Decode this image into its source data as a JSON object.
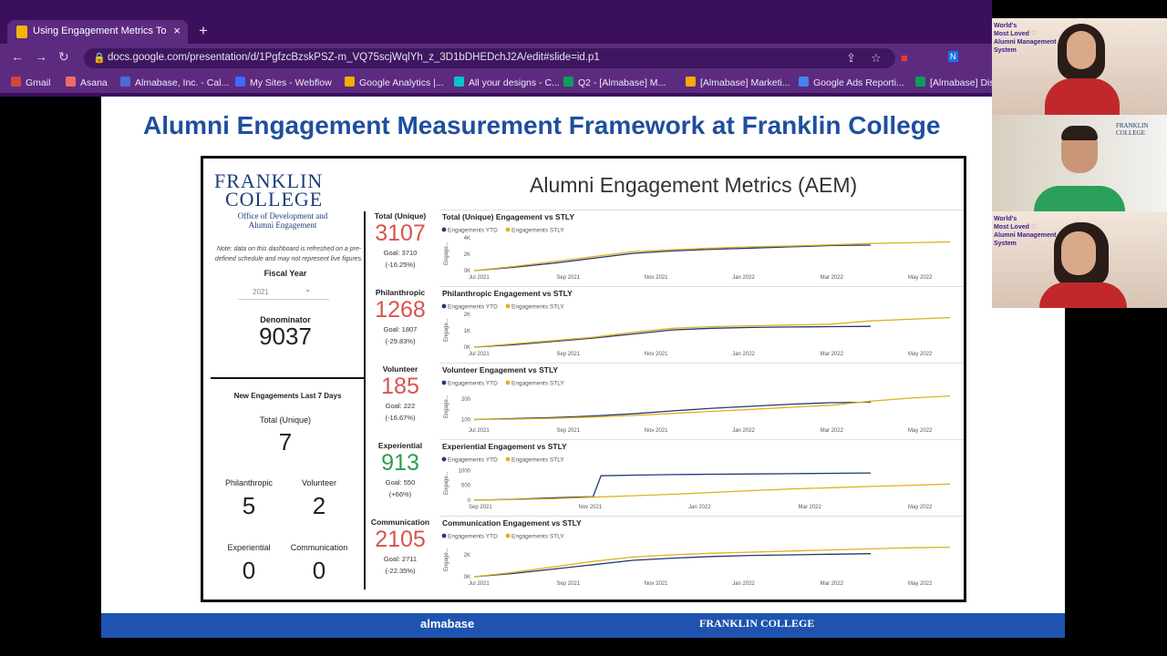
{
  "browser": {
    "tab_title": "Using Engagement Metrics To Dr",
    "url": "docs.google.com/presentation/d/1PgfzcBzskPSZ-m_VQ75scjWqlYh_z_3D1bDHEDchJ2A/edit#slide=id.p1",
    "bookmarks": [
      "Gmail",
      "Asana",
      "Almabase, Inc. - Cal...",
      "My Sites - Webflow",
      "Google Analytics |...",
      "All your designs - C...",
      "Q2 - [Almabase] M...",
      "[Almabase] Marketi...",
      "Google Ads Reporti...",
      "[Almabase] Dis"
    ],
    "bookmark_colors": [
      "#d44638",
      "#f06a6a",
      "#4a6bd6",
      "#3b6bff",
      "#f9ab00",
      "#00c4cc",
      "#0f9d58",
      "#f9ab00",
      "#4285f4",
      "#0f9d58"
    ]
  },
  "slide": {
    "title": "Alumni Engagement Measurement Framework at Franklin College",
    "footer_left": "almabase",
    "footer_right": "FRANKLIN COLLEGE"
  },
  "dashboard": {
    "logo_line1": "FRANKLIN",
    "logo_line2": "COLLEGE",
    "logo_sub1": "Office of Development and",
    "logo_sub2": "Alumni Engagement",
    "note": "Note: data on this dashboard is refreshed on a pre-defined schedule and may not represent live figures.",
    "fiscal_year_label": "Fiscal Year",
    "fiscal_year_value": "2021",
    "denominator_label": "Denominator",
    "denominator_value": "9037",
    "new_title": "New Engagements Last 7 Days",
    "total_unique_label": "Total (Unique)",
    "total_unique_value": "7",
    "philanthropic_label": "Philanthropic",
    "philanthropic_value": "5",
    "volunteer_label": "Volunteer",
    "volunteer_value": "2",
    "experiential_label": "Experiential",
    "experiential_value": "0",
    "communication_label": "Communication",
    "communication_value": "0",
    "title": "Alumni Engagement Metrics (AEM)",
    "kpis": [
      {
        "label": "Total (Unique)",
        "value": "3107",
        "goal": "Goal: 3710",
        "pct": "(-16.25%)",
        "color": "#d9534f"
      },
      {
        "label": "Philanthropic",
        "value": "1268",
        "goal": "Goal: 1807",
        "pct": "(-29.83%)",
        "color": "#d9534f"
      },
      {
        "label": "Volunteer",
        "value": "185",
        "goal": "Goal: 222",
        "pct": "(-16.67%)",
        "color": "#d9534f"
      },
      {
        "label": "Experiential",
        "value": "913",
        "goal": "Goal: 550",
        "pct": "(+66%)",
        "color": "#2e9e4a"
      },
      {
        "label": "Communication",
        "value": "2105",
        "goal": "Goal: 2711",
        "pct": "(-22.35%)",
        "color": "#d9534f"
      }
    ]
  },
  "chart_data": [
    {
      "type": "line",
      "title": "Total (Unique) Engagement vs STLY",
      "ylabel": "Engage...",
      "yticks": [
        "0K",
        "2K",
        "4K"
      ],
      "ylim": [
        0,
        4000
      ],
      "xticks": [
        "Jul 2021",
        "Sep 2021",
        "Nov 2021",
        "Jan 2022",
        "Mar 2022",
        "May 2022"
      ],
      "series": [
        {
          "name": "Engagements YTD",
          "color": "#1f3b73",
          "x": [
            0,
            1,
            2,
            3,
            4,
            5,
            6,
            7,
            8,
            9,
            10
          ],
          "values": [
            0,
            400,
            900,
            1500,
            2100,
            2400,
            2600,
            2750,
            2900,
            3050,
            3107
          ]
        },
        {
          "name": "Engagements STLY",
          "color": "#e0b020",
          "x": [
            0,
            1,
            2,
            3,
            4,
            5,
            6,
            7,
            8,
            9,
            10,
            11,
            12
          ],
          "values": [
            0,
            500,
            1100,
            1700,
            2300,
            2550,
            2750,
            2900,
            3000,
            3150,
            3300,
            3400,
            3500
          ]
        }
      ]
    },
    {
      "type": "line",
      "title": "Philanthropic Engagement vs STLY",
      "ylabel": "Engage...",
      "yticks": [
        "0K",
        "1K",
        "2K"
      ],
      "ylim": [
        0,
        2000
      ],
      "xticks": [
        "Jul 2021",
        "Sep 2021",
        "Nov 2021",
        "Jan 2022",
        "Mar 2022",
        "May 2022"
      ],
      "series": [
        {
          "name": "Engagements YTD",
          "color": "#1f3b73",
          "x": [
            0,
            1,
            2,
            3,
            4,
            5,
            6,
            7,
            8,
            9,
            10
          ],
          "values": [
            0,
            150,
            350,
            550,
            800,
            1050,
            1150,
            1200,
            1230,
            1250,
            1268
          ]
        },
        {
          "name": "Engagements STLY",
          "color": "#e0b020",
          "x": [
            0,
            1,
            2,
            3,
            4,
            5,
            6,
            7,
            8,
            9,
            10,
            11,
            12
          ],
          "values": [
            0,
            200,
            400,
            600,
            900,
            1150,
            1250,
            1300,
            1350,
            1400,
            1600,
            1700,
            1800
          ]
        }
      ]
    },
    {
      "type": "line",
      "title": "Volunteer Engagement vs STLY",
      "ylabel": "Engage...",
      "yticks": [
        "100",
        "200"
      ],
      "ylim": [
        80,
        240
      ],
      "xticks": [
        "Jul 2021",
        "Sep 2021",
        "Nov 2021",
        "Jan 2022",
        "Mar 2022",
        "May 2022"
      ],
      "series": [
        {
          "name": "Engagements YTD",
          "color": "#1f3b73",
          "x": [
            0,
            1,
            2,
            3,
            4,
            5,
            6,
            7,
            8,
            9,
            10
          ],
          "values": [
            100,
            105,
            110,
            118,
            128,
            142,
            155,
            165,
            175,
            182,
            185
          ]
        },
        {
          "name": "Engagements STLY",
          "color": "#e0b020",
          "x": [
            0,
            1,
            2,
            3,
            4,
            5,
            6,
            7,
            8,
            9,
            10,
            11,
            12
          ],
          "values": [
            100,
            102,
            106,
            112,
            120,
            130,
            140,
            150,
            160,
            170,
            190,
            205,
            215
          ]
        }
      ]
    },
    {
      "type": "line",
      "title": "Experiential Engagement vs STLY",
      "ylabel": "Engage...",
      "yticks": [
        "0",
        "500",
        "1000"
      ],
      "ylim": [
        0,
        1100
      ],
      "xticks": [
        "Sep 2021",
        "Nov 2021",
        "Jan 2022",
        "Mar 2022",
        "May 2022"
      ],
      "series": [
        {
          "name": "Engagements YTD",
          "color": "#1f3b73",
          "x": [
            0,
            1,
            2,
            3,
            3.2,
            4,
            5,
            6,
            7,
            8,
            9,
            10
          ],
          "values": [
            0,
            30,
            80,
            120,
            820,
            840,
            860,
            870,
            880,
            890,
            900,
            913
          ]
        },
        {
          "name": "Engagements STLY",
          "color": "#e0b020",
          "x": [
            0,
            1,
            2,
            3,
            4,
            5,
            6,
            7,
            8,
            9,
            10,
            11,
            12
          ],
          "values": [
            0,
            20,
            50,
            100,
            150,
            200,
            260,
            320,
            380,
            420,
            460,
            500,
            540
          ]
        }
      ]
    },
    {
      "type": "line",
      "title": "Communication Engagement vs STLY",
      "ylabel": "Engage...",
      "yticks": [
        "0K",
        "2K"
      ],
      "ylim": [
        0,
        3000
      ],
      "xticks": [
        "Jul 2021",
        "Sep 2021",
        "Nov 2021",
        "Jan 2022",
        "Mar 2022",
        "May 2022"
      ],
      "series": [
        {
          "name": "Engagements YTD",
          "color": "#1f3b73",
          "x": [
            0,
            1,
            2,
            3,
            4,
            5,
            6,
            7,
            8,
            9,
            10
          ],
          "values": [
            0,
            300,
            700,
            1100,
            1500,
            1700,
            1850,
            1950,
            2000,
            2060,
            2105
          ]
        },
        {
          "name": "Engagements STLY",
          "color": "#e0b020",
          "x": [
            0,
            1,
            2,
            3,
            4,
            5,
            6,
            7,
            8,
            9,
            10,
            11,
            12
          ],
          "values": [
            0,
            400,
            900,
            1400,
            1800,
            2000,
            2150,
            2250,
            2350,
            2450,
            2550,
            2650,
            2700
          ]
        }
      ]
    }
  ],
  "video": {
    "brand_line1": "World's",
    "brand_line2": "Most Loved",
    "brand_line3": "Alumni Management",
    "brand_line4": "System"
  }
}
